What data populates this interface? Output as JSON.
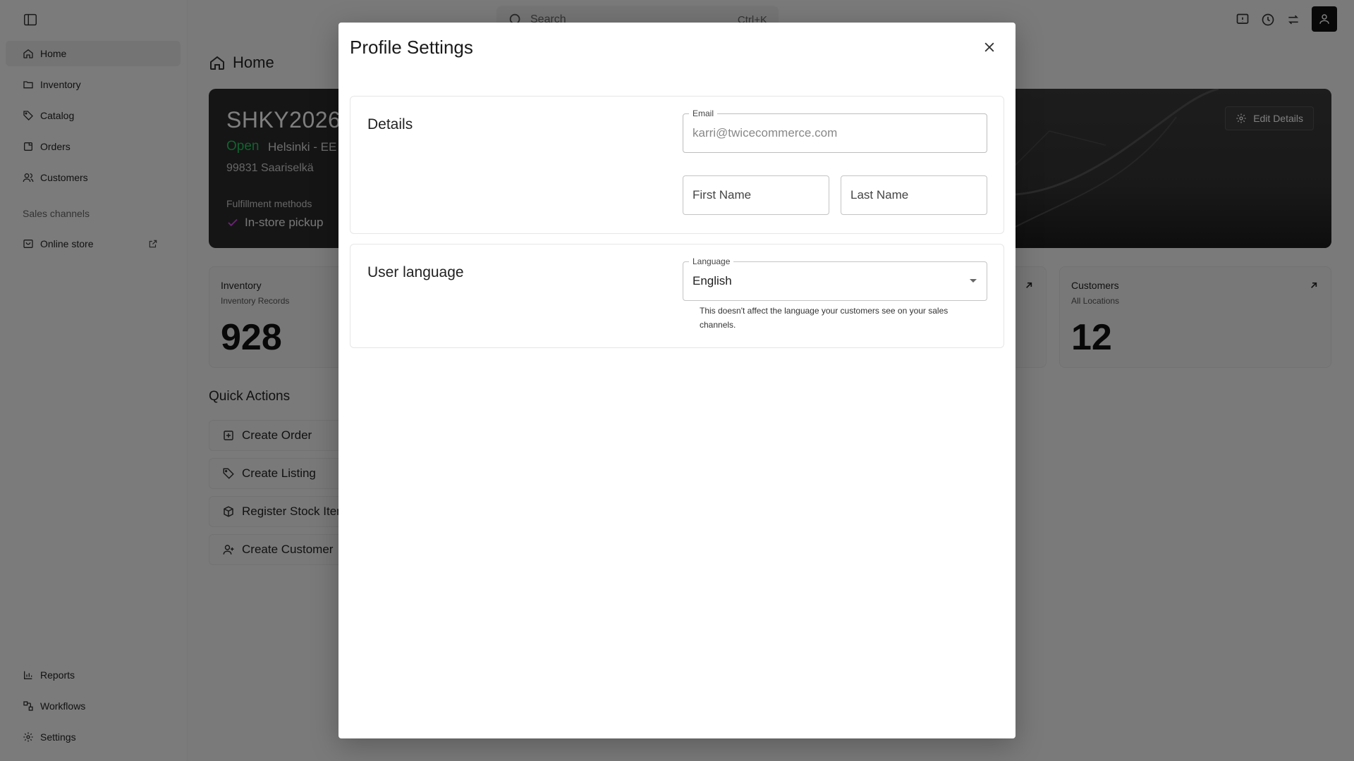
{
  "topbar": {
    "search_placeholder": "Search",
    "search_shortcut": "Ctrl+K"
  },
  "sidebar": {
    "items": [
      {
        "label": "Home",
        "icon": "home-icon"
      },
      {
        "label": "Inventory",
        "icon": "folder-icon"
      },
      {
        "label": "Catalog",
        "icon": "tag-icon"
      },
      {
        "label": "Orders",
        "icon": "order-icon"
      },
      {
        "label": "Customers",
        "icon": "users-icon"
      }
    ],
    "section_label": "Sales channels",
    "channels": [
      {
        "label": "Online store",
        "icon": "store-icon"
      }
    ],
    "bottom_items": [
      {
        "label": "Reports",
        "icon": "chart-icon"
      },
      {
        "label": "Workflows",
        "icon": "workflow-icon"
      },
      {
        "label": "Settings",
        "icon": "gear-icon"
      }
    ]
  },
  "page": {
    "title": "Home"
  },
  "hero": {
    "store_code": "SHKY2026",
    "status": "Open",
    "location": "Helsinki - EE",
    "address": "99831 Saariselkä",
    "fulfillment_label": "Fulfillment methods",
    "pickup_label": "In-store pickup",
    "edit_button": "Edit Details"
  },
  "stats": [
    {
      "title": "Inventory",
      "subtitle": "Inventory Records",
      "value": "928"
    },
    {
      "title": "Customers",
      "subtitle": "All Locations",
      "value": "12"
    }
  ],
  "quick_actions": {
    "title": "Quick Actions",
    "items": [
      {
        "label": "Create Order",
        "icon": "plus-square-icon"
      },
      {
        "label": "Create Listing",
        "icon": "tag-icon"
      },
      {
        "label": "Register Stock Item",
        "icon": "box-icon"
      },
      {
        "label": "Create Customer",
        "icon": "user-plus-icon"
      }
    ]
  },
  "modal": {
    "title": "Profile Settings",
    "details": {
      "title": "Details",
      "email_label": "Email",
      "email_value": "karri@twicecommerce.com",
      "first_name_placeholder": "First Name",
      "last_name_placeholder": "Last Name"
    },
    "language": {
      "title": "User language",
      "label": "Language",
      "value": "English",
      "helper": "This doesn't affect the language your customers see on your sales channels."
    }
  },
  "colors": {
    "status_open": "#22c55e",
    "overlay": "rgba(0,0,0,0.5)",
    "avatar_bg": "#111111"
  }
}
